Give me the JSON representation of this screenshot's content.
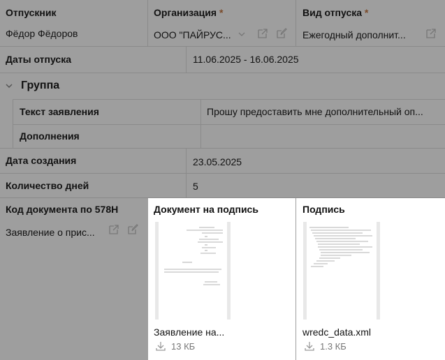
{
  "employee": {
    "label": "Отпускник",
    "value": "Фёдор Фёдоров"
  },
  "organization": {
    "label": "Организация",
    "required_mark": "*",
    "value": "ООО \"ПАЙРУС..."
  },
  "leave_type": {
    "label": "Вид отпуска",
    "required_mark": "*",
    "value": "Ежегодный дополнит..."
  },
  "leave_dates": {
    "label": "Даты отпуска",
    "value": "11.06.2025 - 16.06.2025"
  },
  "group": {
    "label": "Группа",
    "application_text": {
      "label": "Текст заявления",
      "value": "Прошу предоставить мне дополнительный оп..."
    },
    "additions": {
      "label": "Дополнения",
      "value": ""
    }
  },
  "created_date": {
    "label": "Дата создания",
    "value": "23.05.2025"
  },
  "days_count": {
    "label": "Количество дней",
    "value": "5"
  },
  "doc_code": {
    "label": "Код документа по 578Н",
    "value": "Заявление о прис..."
  },
  "files": [
    {
      "title": "Документ на подпись",
      "name": "Заявление на...",
      "size": "13 КБ"
    },
    {
      "title": "Подпись",
      "name": "wredc_data.xml",
      "size": "1.3 КБ"
    }
  ],
  "colors": {
    "overlay_background": "#9e9e9e",
    "panel": "#ffffff",
    "required_mark": "#7a4a2a"
  }
}
